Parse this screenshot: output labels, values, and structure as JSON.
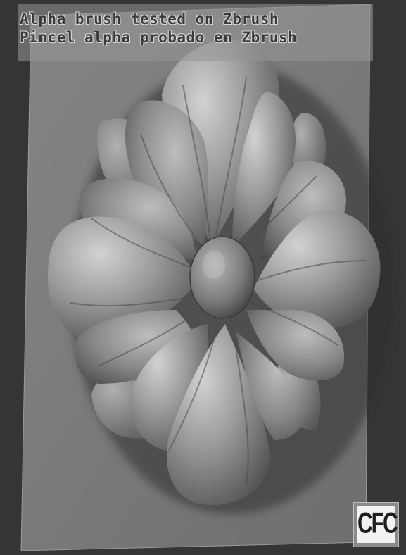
{
  "caption": {
    "line1": "Alpha brush tested on Zbrush",
    "line2": "Pincel alpha probado en Zbrush"
  },
  "logo": {
    "text": "CFC"
  },
  "render": {
    "subject": "flower-relief",
    "colors": {
      "background": "#353535",
      "plate": "#7d7d7d",
      "petal_light": "#c9c9c9",
      "petal_mid": "#8c8c8c",
      "petal_dark": "#3e3e3e"
    }
  }
}
